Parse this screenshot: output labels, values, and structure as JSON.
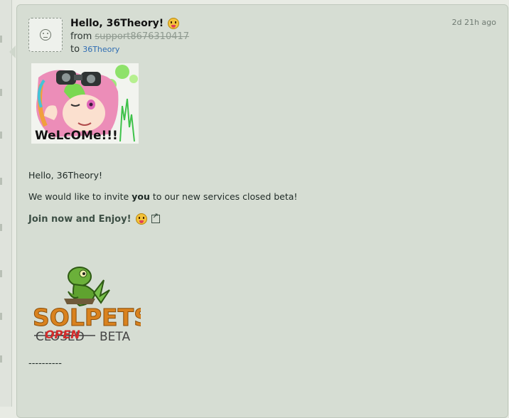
{
  "message": {
    "subject": "Hello, 36Theory!",
    "from_label": "from",
    "from_user": "support8676310417",
    "to_label": "to",
    "to_user": "36Theory",
    "timestamp": "2d 21h ago",
    "greeting": "Hello, 36Theory!",
    "invite_before": "We would like to invite ",
    "invite_bold": "you",
    "invite_after": " to our new services closed beta!",
    "cta": "Join now and Enjoy!",
    "divider": "----------"
  },
  "images": {
    "welcome_text": "WeLcOMe!!!",
    "logo_word": "SOLPETS",
    "logo_closed": "CLOSED",
    "logo_open": "OPEN",
    "logo_beta": "BETA"
  },
  "colors": {
    "card_bg": "#d6ddd3",
    "link": "#2f6db3",
    "cta": "#3d4f45",
    "logo_orange": "#d9821e",
    "logo_green": "#5aa02c"
  },
  "icons": {
    "avatar": "default-avatar-icon",
    "subject_emoji": "tongue-face-emoji",
    "cta_emoji": "yum-face-emoji",
    "external": "external-link-icon"
  }
}
